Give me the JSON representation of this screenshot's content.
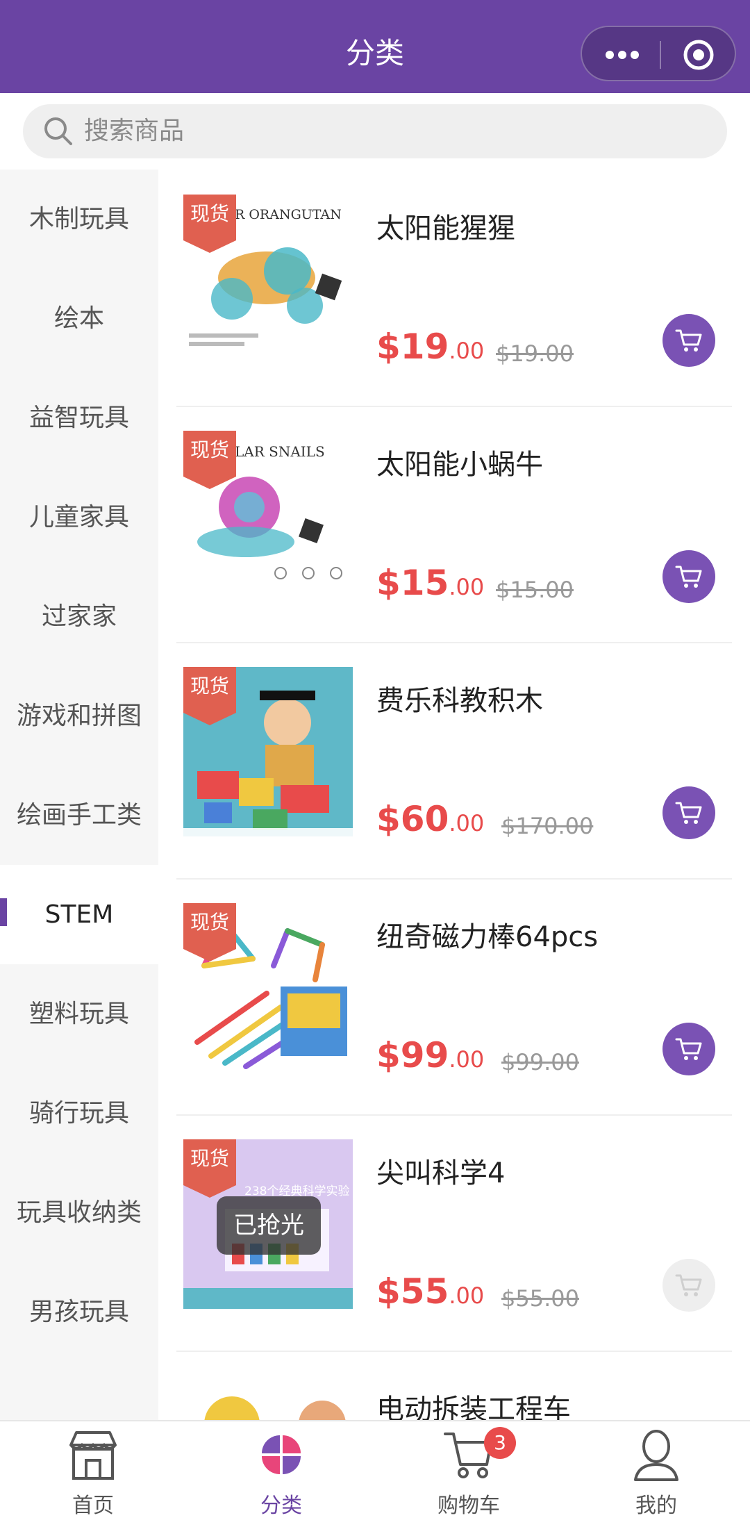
{
  "header": {
    "title": "分类"
  },
  "search": {
    "placeholder": "搜索商品"
  },
  "sidebar": {
    "items": [
      {
        "label": "木制玩具"
      },
      {
        "label": "绘本"
      },
      {
        "label": "益智玩具"
      },
      {
        "label": "儿童家具"
      },
      {
        "label": "过家家"
      },
      {
        "label": "游戏和拼图"
      },
      {
        "label": "绘画手工类"
      },
      {
        "label": "STEM"
      },
      {
        "label": "塑料玩具"
      },
      {
        "label": "骑行玩具"
      },
      {
        "label": "玩具收纳类"
      },
      {
        "label": "男孩玩具"
      }
    ],
    "active": "STEM"
  },
  "products": [
    {
      "name": "太阳能猩猩",
      "badge": "现货",
      "price_int": "$19",
      "price_dec": ".00",
      "original": "$19.00",
      "thumb_text": "R ORANGUTAN",
      "sold_out": false
    },
    {
      "name": "太阳能小蜗牛",
      "badge": "现货",
      "price_int": "$15",
      "price_dec": ".00",
      "original": "$15.00",
      "thumb_text": "LAR SNAILS",
      "sold_out": false
    },
    {
      "name": "费乐科教积木",
      "badge": "现货",
      "price_int": "$60",
      "price_dec": ".00",
      "original": "$170.00",
      "sold_out": false
    },
    {
      "name": "纽奇磁力棒64pcs",
      "badge": "现货",
      "price_int": "$99",
      "price_dec": ".00",
      "original": "$99.00",
      "sold_out": false
    },
    {
      "name": "尖叫科学4",
      "badge": "现货",
      "price_int": "$55",
      "price_dec": ".00",
      "original": "$55.00",
      "sold_out": true,
      "sold_out_label": "已抢光",
      "thumb_text": "238个经典科学实验"
    },
    {
      "name": "电动拆装工程车",
      "partial": true
    }
  ],
  "tabbar": {
    "tabs": [
      {
        "label": "首页",
        "icon": "store-icon"
      },
      {
        "label": "分类",
        "icon": "category-icon",
        "active": true
      },
      {
        "label": "购物车",
        "icon": "cart-icon",
        "badge": "3"
      },
      {
        "label": "我的",
        "icon": "profile-icon"
      }
    ]
  },
  "colors": {
    "brand": "#6a44a3",
    "price": "#e84b4b",
    "cart_button": "#7a52b4",
    "stock_badge": "#e06050"
  }
}
